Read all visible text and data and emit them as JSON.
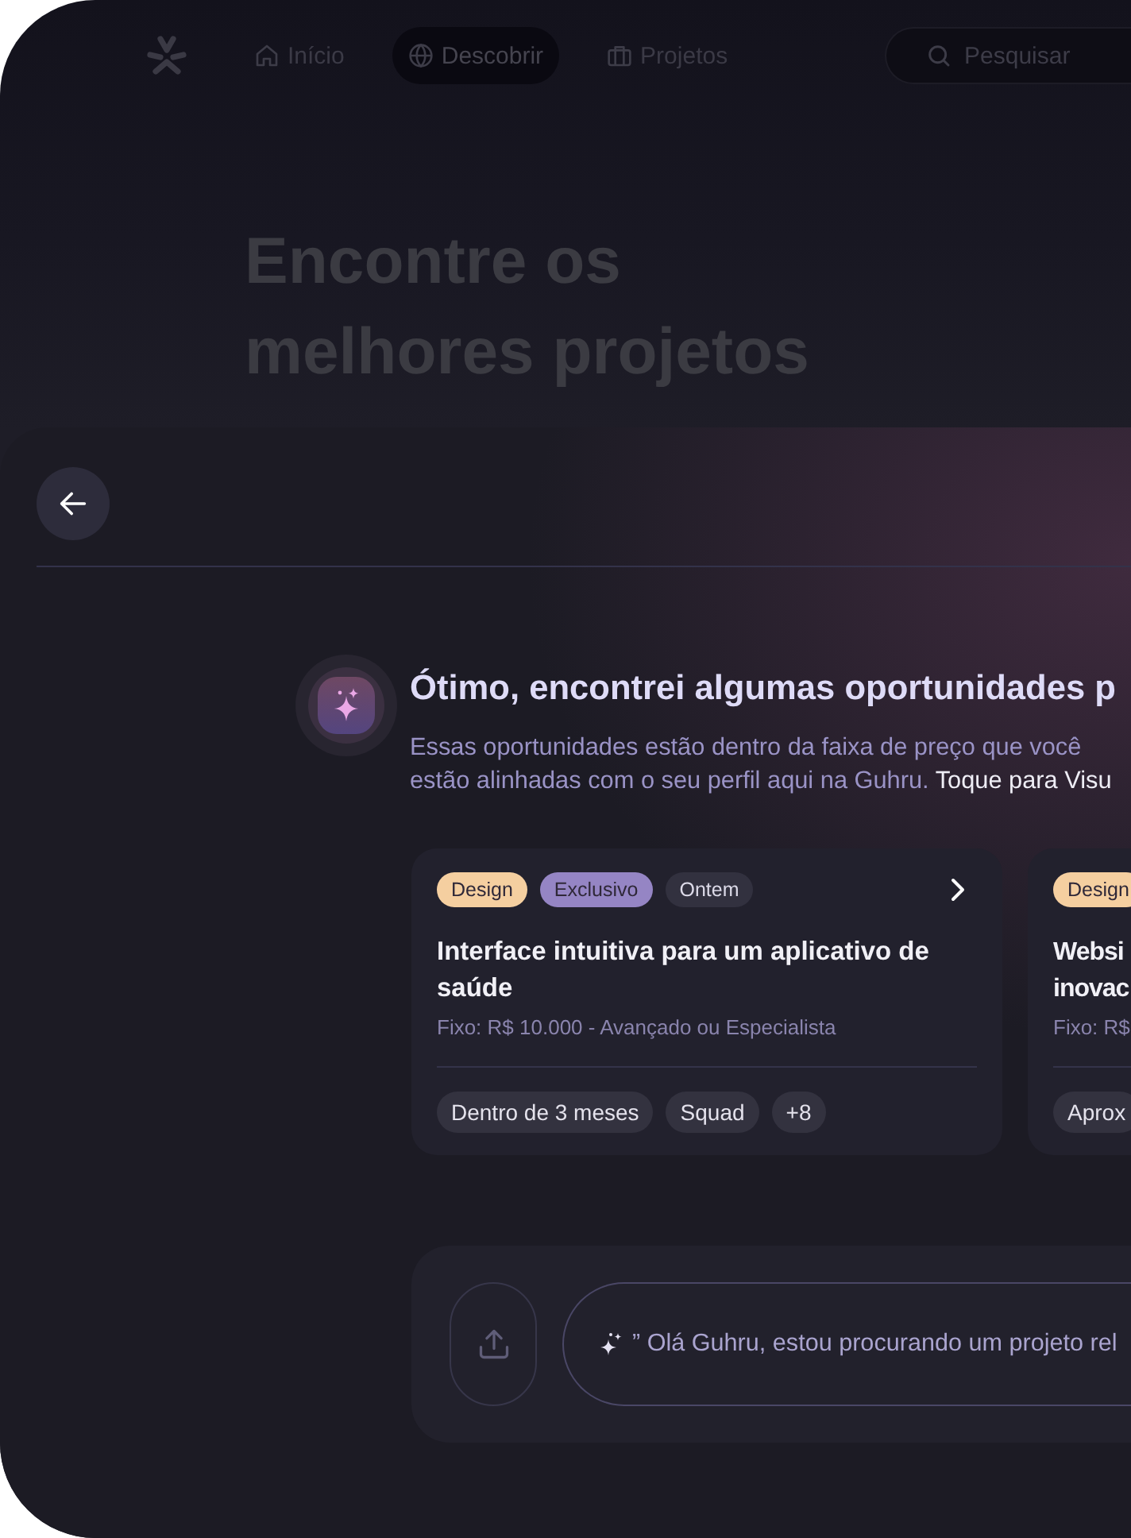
{
  "nav": {
    "tabs": [
      {
        "label": "Início",
        "selected": false
      },
      {
        "label": "Descobrir",
        "selected": true
      },
      {
        "label": "Projetos",
        "selected": false
      }
    ],
    "search": {
      "placeholder": "Pesquisar"
    }
  },
  "hero": {
    "title": "Encontre os melhores projetos"
  },
  "assistant": {
    "title": "Ótimo, encontrei algumas oportunidades p",
    "lines": [
      "Essas oportunidades estão dentro da faixa de preço que você",
      "estão alinhadas com o seu perfil aqui na Guhru."
    ],
    "link": "Toque para Visu"
  },
  "cards": [
    {
      "clipped": false,
      "tags": [
        {
          "label": "Design",
          "color": "#f5cfa0"
        },
        {
          "label": "Exclusivo",
          "color": "#9585c4"
        },
        {
          "label": "Ontem",
          "color": "#32313f"
        }
      ],
      "title": "Interface intuitiva para um aplicativo de saúde",
      "price": "Fixo: R$ 10.000 - Avançado ou Especialista",
      "chips": [
        "Dentro de 3 meses",
        "Squad",
        "+8"
      ]
    },
    {
      "clipped": true,
      "tags": [
        {
          "label": "Design",
          "color": "#f5cfa0"
        }
      ],
      "title": "Websi\ninovac",
      "price": "Fixo: R$",
      "chips": [
        "Aprox"
      ]
    }
  ],
  "composer": {
    "placeholder": "” Olá Guhru, estou procurando um projeto rel"
  }
}
